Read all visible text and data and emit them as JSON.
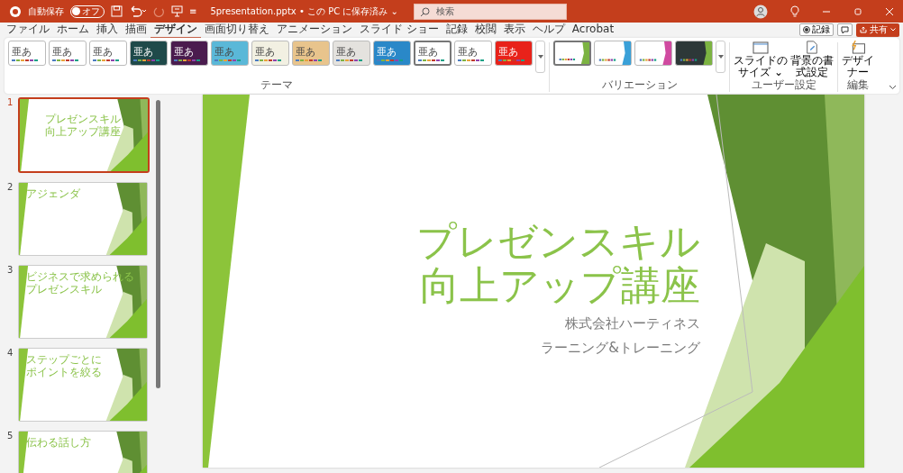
{
  "title_bar": {
    "autosave_label": "自動保存",
    "autosave": {
      "label": "オフ",
      "on": false
    },
    "customize": "≡",
    "file_title": "5presentation.pptx • この PC に保存済み ⌄",
    "search": {
      "placeholder": "検索"
    }
  },
  "menu_tabs": [
    {
      "label": "ファイル",
      "selected": false
    },
    {
      "label": "ホーム",
      "selected": false
    },
    {
      "label": "挿入",
      "selected": false
    },
    {
      "label": "描画",
      "selected": false
    },
    {
      "label": "デザイン",
      "selected": true
    },
    {
      "label": "画面切り替え",
      "selected": false
    },
    {
      "label": "アニメーション",
      "selected": false
    },
    {
      "label": "スライド ショー",
      "selected": false
    },
    {
      "label": "記録",
      "selected": false
    },
    {
      "label": "校閲",
      "selected": false
    },
    {
      "label": "表示",
      "selected": false
    },
    {
      "label": "ヘルプ",
      "selected": false
    },
    {
      "label": "Acrobat",
      "selected": false
    }
  ],
  "record_button": "記録",
  "share_button": "共有",
  "themes": {
    "label": "テーマ",
    "items": [
      {
        "label": "亜あ",
        "color": "#ffffff",
        "selected": false
      },
      {
        "label": "亜あ",
        "color": "#ffffff",
        "selected": false
      },
      {
        "label": "亜あ",
        "color": "#ffffff",
        "selected": false
      },
      {
        "label": "亜あ",
        "color": "#1f4a4a",
        "selected": false
      },
      {
        "label": "亜あ",
        "color": "#4a1c4e",
        "selected": false
      },
      {
        "label": "亜あ",
        "color": "#5ab8d8",
        "selected": false
      },
      {
        "label": "亜あ",
        "color": "#f2f0e2",
        "selected": false
      },
      {
        "label": "亜あ",
        "color": "#e8c48c",
        "selected": false
      },
      {
        "label": "亜あ",
        "color": "#e4e2de",
        "selected": false
      },
      {
        "label": "亜あ",
        "color": "#2a88c8",
        "selected": false
      },
      {
        "label": "亜あ",
        "color": "#ffffff",
        "selected": true
      },
      {
        "label": "亜あ",
        "color": "#ffffff",
        "selected": false
      },
      {
        "label": "亜あ",
        "color": "#e8221a",
        "selected": false
      }
    ]
  },
  "variations": {
    "label": "バリエーション",
    "items": [
      {
        "color": "#7cb342",
        "dark": false,
        "selected": true
      },
      {
        "color": "#3aa0d8",
        "dark": false,
        "selected": false
      },
      {
        "color": "#d04aa0",
        "dark": false,
        "selected": false
      },
      {
        "color": "#7cb342",
        "dark": true,
        "selected": false
      }
    ]
  },
  "customize_group": {
    "label": "ユーザー設定",
    "buttons": [
      "スライドのサイズ ⌄",
      "背景の書式設定"
    ]
  },
  "designer_group": {
    "label": "編集",
    "buttons": [
      "デザイナー"
    ]
  },
  "slides": [
    {
      "number": "1",
      "selected": true,
      "kind": "title",
      "title": "プレゼンスキル向上アップ講座"
    },
    {
      "number": "2",
      "selected": false,
      "kind": "content",
      "title": "アジェンダ"
    },
    {
      "number": "3",
      "selected": false,
      "kind": "content",
      "title": "ビジネスで求められるプレゼンスキル"
    },
    {
      "number": "4",
      "selected": false,
      "kind": "content",
      "title": "ステップごとにポイントを絞る"
    },
    {
      "number": "5",
      "selected": false,
      "kind": "content",
      "title": "伝わる話し方"
    }
  ],
  "main_slide": {
    "title": "プレゼンスキル向上アップ講座",
    "subtitle": [
      "株式会社ハーティネス",
      "ラーニング&トレーニング"
    ]
  }
}
